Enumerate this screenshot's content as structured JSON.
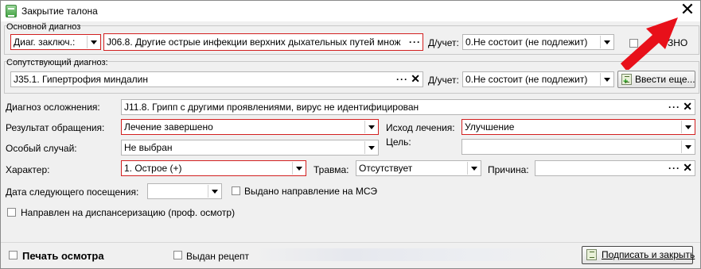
{
  "window": {
    "title": "Закрытие талона"
  },
  "primary_diagnosis": {
    "group_label": "Основной диагноз",
    "type_value": "Диаг. заключ.:",
    "diagnosis_value": "J06.8. Другие острые инфекции верхних дыхательных путей множ",
    "dots": "···",
    "registration_label": "Д/учет:",
    "registration_value": "0.Не состоит (не подлежит)",
    "zno_label": "ЗНО",
    "zno_checked": false
  },
  "concomitant_diagnosis": {
    "group_label": "Сопутствующий диагноз:",
    "diagnosis_value": "J35.1. Гипертрофия миндалин",
    "dots": "···",
    "clear_icon": "✕",
    "registration_label": "Д/учет:",
    "registration_value": "0.Не состоит (не подлежит)",
    "enter_more_label": "Ввести еще..."
  },
  "complication": {
    "label": "Диагноз осложнения:",
    "value": "J11.8. Грипп с другими проявлениями, вирус не идентифицирован",
    "dots": "···",
    "clear_icon": "✕"
  },
  "result": {
    "label": "Результат обращения:",
    "value": "Лечение завершено"
  },
  "outcome": {
    "label": "Исход лечения:",
    "value": "Улучшение"
  },
  "special_case": {
    "label": "Особый случай:",
    "value": "Не выбран"
  },
  "goal": {
    "label": "Цель:",
    "value": ""
  },
  "character": {
    "label": "Характер:",
    "value": "1. Острое (+)"
  },
  "trauma": {
    "label": "Травма:",
    "value": "Отсутствует"
  },
  "reason": {
    "label": "Причина:",
    "value": "",
    "dots": "···",
    "clear_icon": "✕"
  },
  "next_visit": {
    "label": "Дата следующего посещения:",
    "value": ""
  },
  "mse_referral": {
    "label": "Выдано направление на МСЭ",
    "checked": false
  },
  "dispensary": {
    "label": "Направлен на диспансеризацию (проф. осмотр)",
    "checked": false
  },
  "footer": {
    "print_label": "Печать осмотра",
    "print_checked": false,
    "prescription_label": "Выдан рецепт",
    "prescription_checked": false,
    "sign_close_label": "Подписать и закрыть"
  },
  "icons": {
    "close": "close-icon",
    "app": "app-icon",
    "annotation_arrow": "red-arrow-annotation",
    "accent_red": "#d22020",
    "arrow_red": "#e8101a"
  }
}
